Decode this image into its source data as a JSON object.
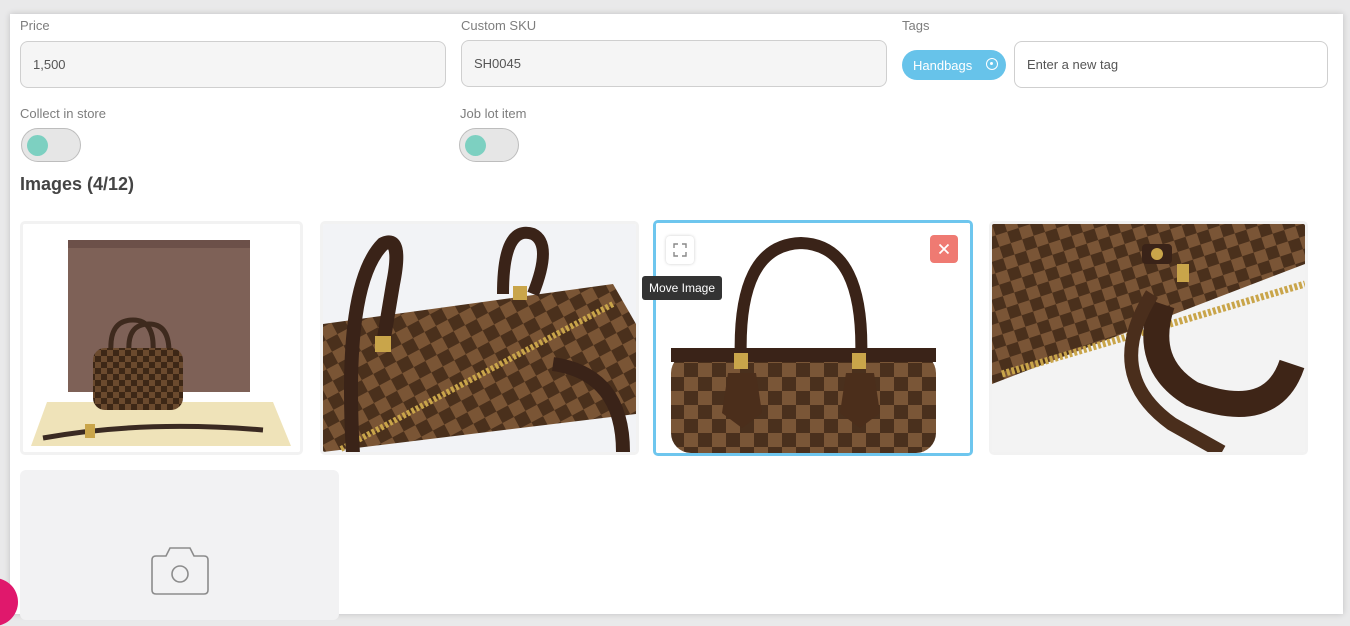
{
  "form": {
    "price": {
      "label": "Price",
      "value": "1,500"
    },
    "custom_sku": {
      "label": "Custom SKU",
      "value": "SH0045"
    },
    "tags": {
      "label": "Tags",
      "chips": [
        "Handbags"
      ],
      "placeholder": "Enter a new tag"
    },
    "collect_in_store": {
      "label": "Collect in store",
      "enabled": true
    },
    "job_lot_item": {
      "label": "Job lot item",
      "enabled": true
    }
  },
  "images": {
    "heading": "Images (4/12)",
    "items": [
      {
        "alt": "Bag with box"
      },
      {
        "alt": "Zipper close-up"
      },
      {
        "alt": "Front view",
        "selected": true
      },
      {
        "alt": "Handle close-up"
      }
    ],
    "move_tooltip": "Move Image",
    "accent": "#6ec6ee",
    "delete_color": "#ef7a72"
  },
  "icons": {
    "move": "expand-arrows-icon",
    "delete": "close-icon",
    "add": "camera-icon",
    "chip_remove": "circle-dot-icon"
  }
}
